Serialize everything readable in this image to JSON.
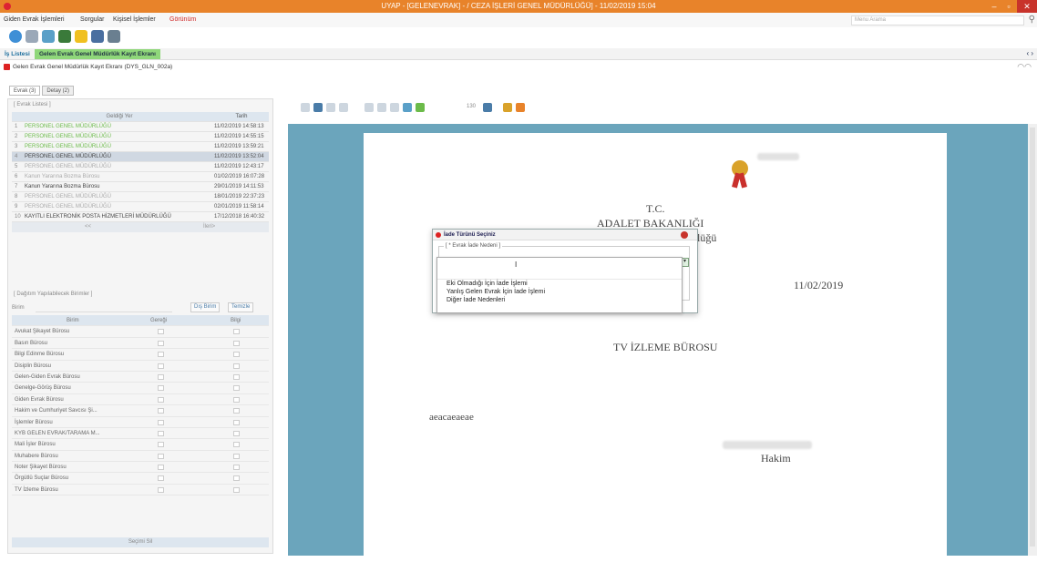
{
  "titlebar": {
    "title": "UYAP - [GELENEVRAK] - / CEZA İŞLERİ GENEL MÜDÜRLÜĞÜ] - 11/02/2019 15:04",
    "minimize": "–",
    "maximize": "▫",
    "close": "✕",
    "color": "#e8832a"
  },
  "menu": {
    "items": [
      "Giden Evrak İşlemleri",
      "Sorgular",
      "Kişisel İşlemler",
      "Görünüm"
    ],
    "search_placeholder": "Menu Arama"
  },
  "tabs": {
    "items": [
      "İş Listesi",
      "Gelen Evrak Genel Müdürlük Kayıt Ekranı"
    ],
    "arrows": "‹ ›"
  },
  "subhead": {
    "title": "Gelen Evrak Genel Müdürlük Kayıt Ekranı (DYS_GLN_002a)"
  },
  "inner_tabs": [
    "Evrak (3)",
    "Detay (2)"
  ],
  "evrak_listesi": {
    "label": "[ Evrak Listesi ]",
    "headers": [
      "Geldiği Yer",
      "Tarih"
    ],
    "rows": [
      {
        "n": "1",
        "geldigi_yer": "PERSONEL GENEL MÜDÜRLÜĞÜ",
        "tarih": "11/02/2019 14:58:13"
      },
      {
        "n": "2",
        "geldigi_yer": "PERSONEL GENEL MÜDÜRLÜĞÜ",
        "tarih": "11/02/2019 14:55:15"
      },
      {
        "n": "3",
        "geldigi_yer": "PERSONEL GENEL MÜDÜRLÜĞÜ",
        "tarih": "11/02/2019 13:59:21"
      },
      {
        "n": "4",
        "geldigi_yer": "PERSONEL GENEL MÜDÜRLÜĞÜ",
        "tarih": "11/02/2019 13:52:04"
      },
      {
        "n": "5",
        "geldigi_yer": "PERSONEL GENEL MÜDÜRLÜĞÜ",
        "tarih": "11/02/2019 12:43:17"
      },
      {
        "n": "6",
        "geldigi_yer": "Kanun Yararına Bozma Bürosu",
        "tarih": "01/02/2019 16:07:28"
      },
      {
        "n": "7",
        "geldigi_yer": "Kanun Yararına Bozma Bürosu",
        "tarih": "29/01/2019 14:11:53"
      },
      {
        "n": "8",
        "geldigi_yer": "PERSONEL GENEL MÜDÜRLÜĞÜ",
        "tarih": "18/01/2019 22:37:23"
      },
      {
        "n": "9",
        "geldigi_yer": "PERSONEL GENEL MÜDÜRLÜĞÜ",
        "tarih": "02/01/2019 11:58:14"
      },
      {
        "n": "10",
        "geldigi_yer": "KAYITLI ELEKTRONİK POSTA HİZMETLERİ MÜDÜRLÜĞÜ",
        "tarih": "17/12/2018 16:40:32"
      }
    ],
    "paging_left": "<<",
    "paging_right": "İleri>"
  },
  "dagitim": {
    "label": "[ Dağıtım Yapılabilecek Birimler ]",
    "birim_label": "Birim",
    "btn_dis_birim": "Dış Birim",
    "btn_temizle": "Temizle",
    "headers": [
      "Birim",
      "Gereği",
      "Bilgi"
    ],
    "rows": [
      "Avukat Şikayet Bürosu",
      "Basın Bürosu",
      "Bilgi Edinme Bürosu",
      "Disiplin Bürosu",
      "Gelen-Giden Evrak Bürosu",
      "Genelge-Görüş Bürosu",
      "Giden Evrak Bürosu",
      "Hakim ve Cumhuriyet Savcısı Şi...",
      "İşlemler Bürosu",
      "KYB GELEN EVRAK/TARAMA M...",
      "Mali İşler Bürosu",
      "Muhabere Bürosu",
      "Noter Şikayet Bürosu",
      "Örgütlü Suçlar Bürosu",
      "TV İzleme Bürosu"
    ],
    "bottom_button": "Seçimi Sil"
  },
  "viewer": {
    "zoom": "130",
    "bg": "#6ba5bc"
  },
  "document": {
    "tc": "T.C.",
    "ministry": "ADALET BAKANLIĞI",
    "directorate_suffix": "rlüğü",
    "date": "11/02/2019",
    "recipient": "TV İZLEME BÜROSU",
    "body": "aeacaeaeae",
    "signer_title": "Hakim"
  },
  "dialog": {
    "title": "İade Türünü Seçiniz",
    "group_label": "[ * Evrak İade Nedeni ]",
    "options": [
      "Eki Olmadığı İçin İade İşlemi",
      "Yanlış Gelen Evrak İçin İade İşlemi",
      "Diğer İade Nedenleri"
    ]
  }
}
